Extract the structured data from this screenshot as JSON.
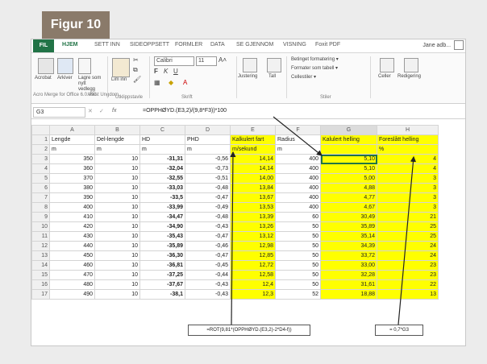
{
  "figure_label": "Figur 10",
  "ribbon": {
    "tabs": [
      "FIL",
      "HJEM",
      "SETT INN",
      "SIDEOPPSETT",
      "FORMLER",
      "DATA",
      "SE GJENNOM",
      "VISNING",
      "Foxit PDF"
    ],
    "user": "Jane adb...",
    "font_name": "Calibri",
    "font_size": "11",
    "groups": {
      "clipboard_label": "Utklippstavle",
      "font_label": "Skrift",
      "styles_label": "Stiler",
      "acrobat_label": "Ulest Ungdom",
      "conditional_formatting": "Betinget formatering",
      "format_as_table": "Formater som tabell",
      "cell_styles": "Cellestiler",
      "alignment": "Justering",
      "number": "Tall",
      "cells": "Celler",
      "editing": "Redigering",
      "paste": "Lim inn",
      "acrobat": "Acrobat",
      "pdf_btn": "Arkiver",
      "save_as": "Lagre som nytt vedlegg",
      "office_line": "Acro Merge for Office 6.0.490"
    }
  },
  "formula_bar": {
    "name_box": "G3",
    "fx": "fx",
    "formula": "=OPPHØYD.(E3,2)/(9,8*F3))*100"
  },
  "columns": [
    "A",
    "B",
    "C",
    "D",
    "E",
    "F",
    "G",
    "H"
  ],
  "header_row": [
    "Lengde",
    "Del-lengde",
    "HD",
    "PHD",
    "Kalkulert fart",
    "Radius",
    "Kalulert helling",
    "Foreslått helling"
  ],
  "unit_row": [
    "m",
    "m",
    "m",
    "m",
    "m/sekund",
    "m",
    "",
    "%"
  ],
  "rows": [
    [
      "3",
      "350",
      "10",
      "-31,31",
      "-0,56",
      "14,14",
      "400",
      "5,10",
      "4"
    ],
    [
      "4",
      "360",
      "10",
      "-32,04",
      "-0,73",
      "14,14",
      "400",
      "5,10",
      "4"
    ],
    [
      "5",
      "370",
      "10",
      "-32,55",
      "-0,51",
      "14,00",
      "400",
      "5,00",
      "3"
    ],
    [
      "6",
      "380",
      "10",
      "-33,03",
      "-0,48",
      "13,84",
      "400",
      "4,88",
      "3"
    ],
    [
      "7",
      "390",
      "10",
      "-33,5",
      "-0,47",
      "13,67",
      "400",
      "4,77",
      "3"
    ],
    [
      "8",
      "400",
      "10",
      "-33,99",
      "-0,49",
      "13,53",
      "400",
      "4,67",
      "3"
    ],
    [
      "9",
      "410",
      "10",
      "-34,47",
      "-0,48",
      "13,39",
      "60",
      "30,49",
      "21"
    ],
    [
      "10",
      "420",
      "10",
      "-34,90",
      "-0,43",
      "13,26",
      "50",
      "35,89",
      "25"
    ],
    [
      "11",
      "430",
      "10",
      "-35,43",
      "-0,47",
      "13,12",
      "50",
      "35,14",
      "25"
    ],
    [
      "12",
      "440",
      "10",
      "-35,89",
      "-0,46",
      "12,98",
      "50",
      "34,39",
      "24"
    ],
    [
      "13",
      "450",
      "10",
      "-36,30",
      "-0,47",
      "12,85",
      "50",
      "33,72",
      "24"
    ],
    [
      "14",
      "460",
      "10",
      "-36,81",
      "-0,45",
      "12,72",
      "50",
      "33,00",
      "23"
    ],
    [
      "15",
      "470",
      "10",
      "-37,25",
      "-0,44",
      "12,58",
      "50",
      "32,28",
      "23"
    ],
    [
      "16",
      "480",
      "10",
      "-37,67",
      "-0,43",
      "12,4",
      "50",
      "31,61",
      "22"
    ],
    [
      "17",
      "490",
      "10",
      "-38,1",
      "-0,43",
      "12,3",
      "52",
      "18,88",
      "13"
    ]
  ],
  "callouts": {
    "speed_formula": "=ROT(9,81*(OPPHØYD.(E3,2)-2*D4-f))",
    "slope_formula": "= 0,7*G3"
  }
}
